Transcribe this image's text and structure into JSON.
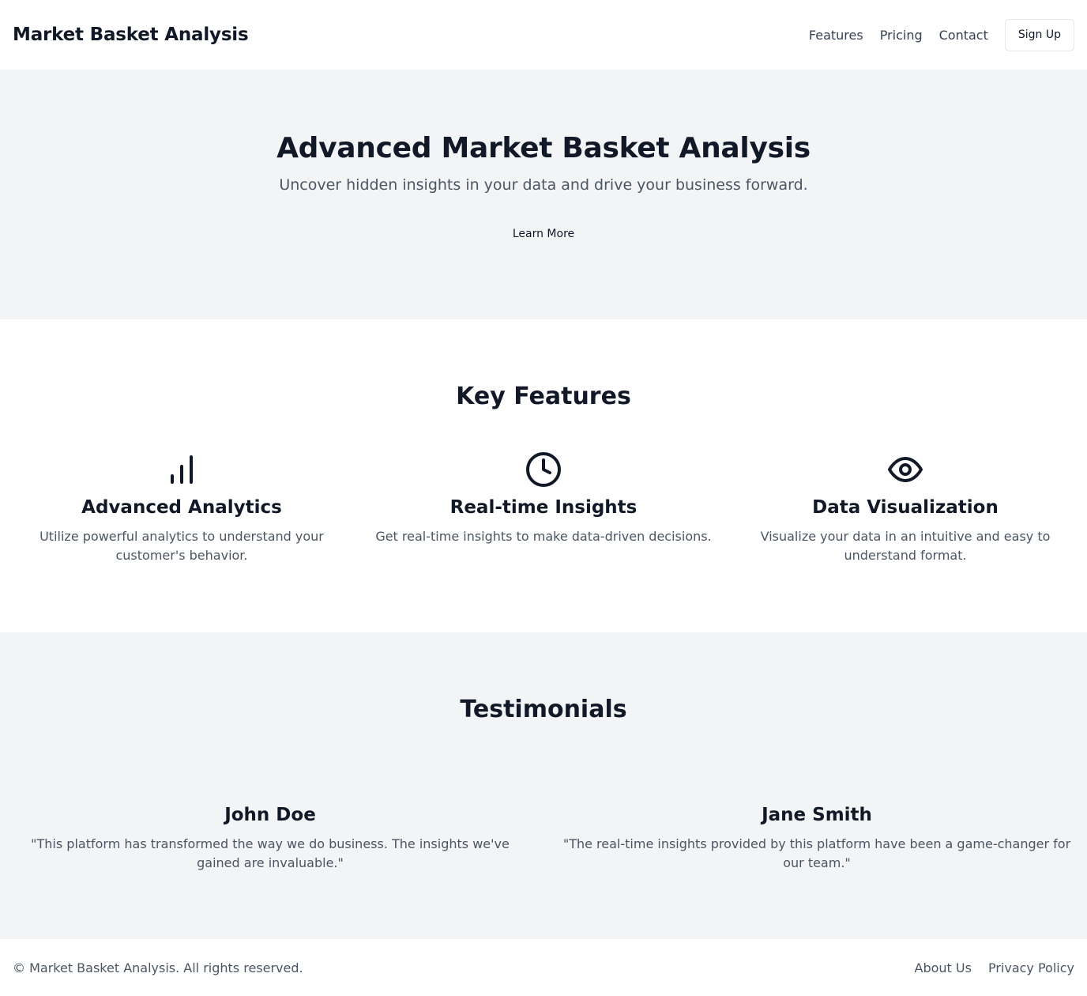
{
  "header": {
    "brand": "Market Basket Analysis",
    "nav": [
      {
        "label": "Features"
      },
      {
        "label": "Pricing"
      },
      {
        "label": "Contact"
      }
    ],
    "signup_label": "Sign Up"
  },
  "hero": {
    "title": "Advanced Market Basket Analysis",
    "subtitle": "Uncover hidden insights in your data and drive your business forward.",
    "cta_label": "Learn More"
  },
  "features": {
    "title": "Key Features",
    "items": [
      {
        "icon": "bar-chart-icon",
        "title": "Advanced Analytics",
        "description": "Utilize powerful analytics to understand your customer's behavior."
      },
      {
        "icon": "clock-icon",
        "title": "Real-time Insights",
        "description": "Get real-time insights to make data-driven decisions."
      },
      {
        "icon": "eye-icon",
        "title": "Data Visualization",
        "description": "Visualize your data in an intuitive and easy to understand format."
      }
    ]
  },
  "testimonials": {
    "title": "Testimonials",
    "items": [
      {
        "name": "John Doe",
        "quote": "\"This platform has transformed the way we do business. The insights we've gained are invaluable.\""
      },
      {
        "name": "Jane Smith",
        "quote": "\"The real-time insights provided by this platform have been a game-changer for our team.\""
      }
    ]
  },
  "footer": {
    "copyright": "© Market Basket Analysis. All rights reserved.",
    "links": [
      {
        "label": "About Us"
      },
      {
        "label": "Privacy Policy"
      }
    ]
  },
  "colors": {
    "text_primary": "#111827",
    "text_secondary": "#4b5563",
    "section_bg": "#f3f4f6"
  }
}
